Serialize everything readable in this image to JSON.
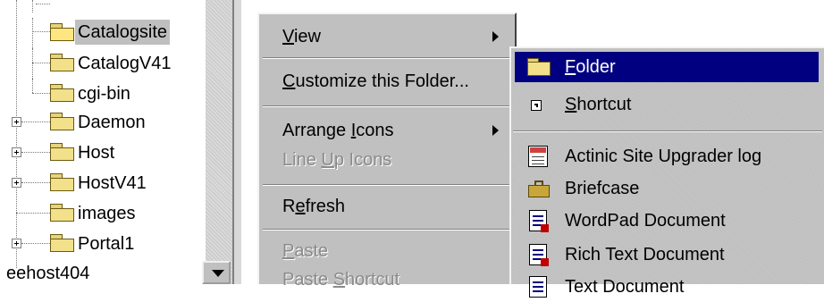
{
  "tree": {
    "items": [
      {
        "label": "Catalogsite",
        "expandable": false,
        "selected": true
      },
      {
        "label": "CatalogV41",
        "expandable": false,
        "selected": false
      },
      {
        "label": "cgi-bin",
        "expandable": false,
        "selected": false
      },
      {
        "label": "Daemon",
        "expandable": true,
        "selected": false
      },
      {
        "label": "Host",
        "expandable": true,
        "selected": false
      },
      {
        "label": "HostV41",
        "expandable": true,
        "selected": false
      },
      {
        "label": "images",
        "expandable": false,
        "selected": false
      },
      {
        "label": "Portal1",
        "expandable": true,
        "selected": false
      }
    ],
    "root_label": "eehost404"
  },
  "context_menu": {
    "items": [
      {
        "label": "View",
        "accel": "V",
        "submenu": true,
        "disabled": false
      },
      {
        "label": "Customize this Folder...",
        "accel": "C",
        "submenu": false,
        "disabled": false
      },
      {
        "label": "Arrange Icons",
        "accel": "I",
        "submenu": true,
        "disabled": false
      },
      {
        "label": "Line Up Icons",
        "accel": "U",
        "submenu": false,
        "disabled": true
      },
      {
        "label": "Refresh",
        "accel": "e",
        "submenu": false,
        "disabled": false
      },
      {
        "label": "Paste",
        "accel": "P",
        "submenu": false,
        "disabled": true
      },
      {
        "label": "Paste Shortcut",
        "accel": "S",
        "submenu": false,
        "disabled": true
      }
    ]
  },
  "new_submenu": {
    "items": [
      {
        "label": "Folder",
        "accel": "F",
        "icon": "folder-icon",
        "highlighted": true
      },
      {
        "label": "Shortcut",
        "accel": "S",
        "icon": "shortcut-icon",
        "highlighted": false
      },
      {
        "label": "Actinic Site Upgrader log",
        "icon": "document-log-icon",
        "highlighted": false
      },
      {
        "label": "Briefcase",
        "icon": "briefcase-icon",
        "highlighted": false
      },
      {
        "label": "WordPad Document",
        "icon": "wordpad-document-icon",
        "highlighted": false
      },
      {
        "label": "Rich Text Document",
        "icon": "rich-text-document-icon",
        "highlighted": false
      },
      {
        "label": "Text Document",
        "icon": "text-document-icon",
        "highlighted": false
      }
    ]
  },
  "colors": {
    "menu_face": "#c0c0c0",
    "highlight": "#000080",
    "highlight_text": "#ffffff",
    "disabled_text": "#8a8a8a"
  }
}
